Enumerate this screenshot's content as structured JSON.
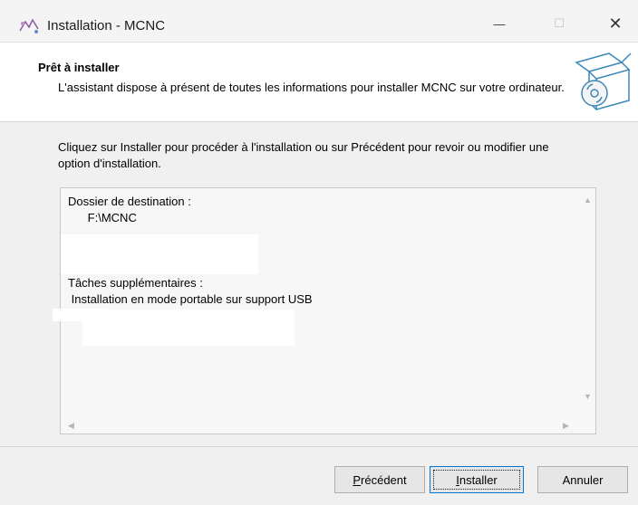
{
  "window": {
    "title": "Installation - MCNC",
    "minimize_glyph": "—",
    "maximize_glyph": "☐",
    "close_glyph": "✕"
  },
  "header": {
    "title": "Prêt à installer",
    "description": "L'assistant dispose à présent de toutes les informations pour installer MCNC sur votre ordinateur."
  },
  "intro_text": "Cliquez sur Installer pour procéder à l'installation ou sur Précédent pour revoir ou modifier une option d'installation.",
  "memo": {
    "dest_label": "Dossier de destination :",
    "dest_value": "F:\\MCNC",
    "tasks_label": "Tâches supplémentaires :",
    "tasks_value": "Installation en mode portable sur support USB"
  },
  "buttons": {
    "prev_first": "P",
    "prev_rest": "récédent",
    "install_first": "I",
    "install_rest": "nstaller",
    "cancel": "Annuler"
  },
  "icons": {
    "app": "installer-app-icon",
    "header": "box-with-disc-icon"
  }
}
